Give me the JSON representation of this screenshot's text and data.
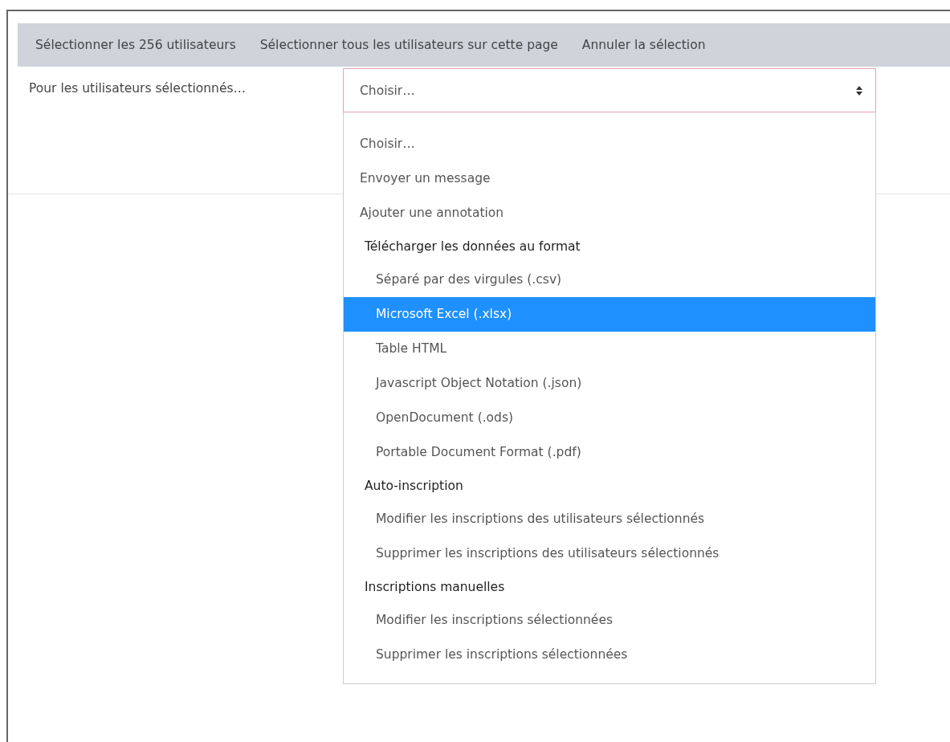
{
  "bulk_actions": [
    {
      "label": "Sélectionner les 256 utilisateurs"
    },
    {
      "label": "Sélectionner tous les utilisateurs sur cette page"
    },
    {
      "label": "Annuler la sélection"
    }
  ],
  "action_select": {
    "label": "Pour les utilisateurs sélectionnés…",
    "value": "Choisir…",
    "expanded": true
  },
  "options": [
    {
      "kind": "option",
      "label": "Choisir…",
      "selected": false
    },
    {
      "kind": "option",
      "label": "Envoyer un message",
      "selected": false
    },
    {
      "kind": "option",
      "label": "Ajouter une annotation",
      "selected": false
    },
    {
      "kind": "group",
      "label": "Télécharger les données au format",
      "children": [
        {
          "label": "Séparé par des virgules (.csv)",
          "selected": false
        },
        {
          "label": "Microsoft Excel (.xlsx)",
          "selected": true
        },
        {
          "label": "Table HTML",
          "selected": false
        },
        {
          "label": "Javascript Object Notation (.json)",
          "selected": false
        },
        {
          "label": "OpenDocument (.ods)",
          "selected": false
        },
        {
          "label": "Portable Document Format (.pdf)",
          "selected": false
        }
      ]
    },
    {
      "kind": "group",
      "label": "Auto-inscription",
      "children": [
        {
          "label": "Modifier les inscriptions des utilisateurs sélectionnés",
          "selected": false
        },
        {
          "label": "Supprimer les inscriptions des utilisateurs sélectionnés",
          "selected": false
        }
      ]
    },
    {
      "kind": "group",
      "label": "Inscriptions manuelles",
      "children": [
        {
          "label": "Modifier les inscriptions sélectionnées",
          "selected": false
        },
        {
          "label": "Supprimer les inscriptions sélectionnées",
          "selected": false
        }
      ]
    }
  ]
}
